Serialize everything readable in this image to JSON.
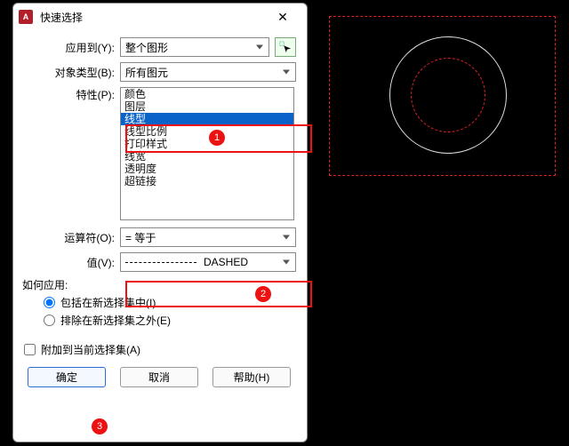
{
  "titlebar": {
    "app_letter": "A",
    "title": "快速选择"
  },
  "rows": {
    "apply_to": {
      "label": "应用到(Y):",
      "value": "整个图形"
    },
    "obj_type": {
      "label": "对象类型(B):",
      "value": "所有图元"
    },
    "props": {
      "label": "特性(P):"
    },
    "operator": {
      "label": "运算符(O):",
      "value": "= 等于"
    },
    "value": {
      "label": "值(V):",
      "value": "DASHED"
    }
  },
  "prop_list": [
    "颜色",
    "图层",
    "线型",
    "线型比例",
    "打印样式",
    "线宽",
    "透明度",
    "超链接"
  ],
  "prop_selected_index": 2,
  "how_apply": {
    "group_label": "如何应用:",
    "opt_include": "包括在新选择集中(I)",
    "opt_exclude": "排除在新选择集之外(E)"
  },
  "append": {
    "label": "附加到当前选择集(A)"
  },
  "buttons": {
    "ok": "确定",
    "cancel": "取消",
    "help": "帮助(H)"
  },
  "badges": {
    "b1": "1",
    "b2": "2",
    "b3": "3"
  },
  "icons": {
    "close": "✕",
    "pick_tooltip": "选择对象"
  }
}
